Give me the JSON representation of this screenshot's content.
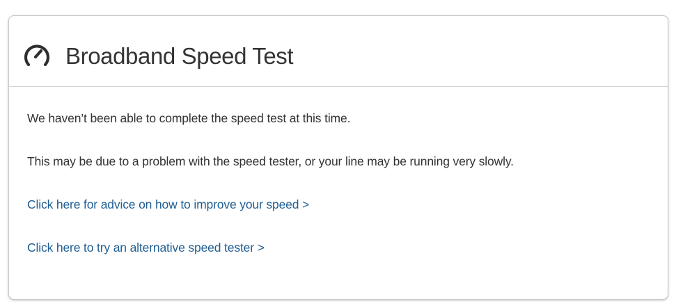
{
  "panel": {
    "title": "Broadband Speed Test",
    "icon": "speedometer-icon",
    "messages": [
      "We haven’t been able to complete the speed test at this time.",
      "This may be due to a problem with the speed tester, or your line may be running very slowly."
    ],
    "links": [
      "Click here for advice on how to improve your speed >",
      "Click here to try an alternative speed tester >"
    ]
  },
  "colors": {
    "text": "#333333",
    "link": "#1f5e94",
    "border": "#c9c9c9"
  }
}
